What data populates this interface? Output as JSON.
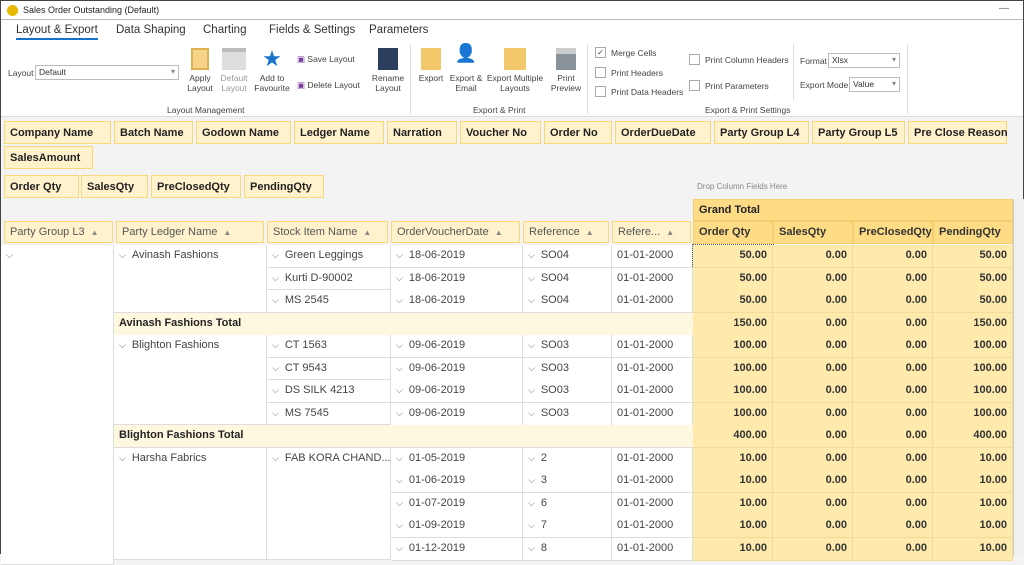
{
  "window": {
    "title": "Sales Order Outstanding (Default)",
    "minimize": "—"
  },
  "tabs": [
    "Layout & Export",
    "Data Shaping",
    "Charting",
    "Fields & Settings",
    "Parameters"
  ],
  "ribbon": {
    "layout_label": "Layout",
    "layout_value": "Default",
    "apply": "Apply Layout",
    "default": "Default Layout",
    "favourite": "Add to Favourite",
    "save": "Save Layout",
    "delete": "Delete Layout",
    "rename": "Rename Layout",
    "group1": "Layout Management",
    "export": "Export",
    "export_email": "Export & Email",
    "export_multiple": "Export Multiple Layouts",
    "print_preview": "Print Preview",
    "group2": "Export & Print",
    "merge_cells": "Merge Cells",
    "merge_checked": true,
    "print_headers": "Print Headers",
    "print_data_headers": "Print Data Headers",
    "print_column_headers": "Print Column Headers",
    "print_parameters": "Print Parameters",
    "format_label": "Format",
    "format_value": "Xlsx",
    "mode_label": "Export Mode",
    "mode_value": "Value",
    "group3": "Export & Print Settings"
  },
  "filter_fields": [
    "Company Name",
    "Batch Name",
    "Godown Name",
    "Ledger Name",
    "Narration",
    "Voucher No",
    "Order No",
    "OrderDueDate",
    "Party Group L4",
    "Party Group L5",
    "Pre Close Reason",
    "SalesAmount"
  ],
  "data_fields": [
    "Order Qty",
    "SalesQty",
    "PreClosedQty",
    "PendingQty"
  ],
  "drop_hint": "Drop Column Fields Here",
  "row_headers": [
    "Party Group L3",
    "Party Ledger Name",
    "Stock Item Name",
    "OrderVoucherDate",
    "Reference",
    "Refere..."
  ],
  "grand_total": "Grand Total",
  "value_headers": [
    "Order Qty",
    "SalesQty",
    "PreClosedQty",
    "PendingQty"
  ],
  "groups": [
    {
      "ledger": "Avinash Fashions",
      "items": [
        {
          "stock": "Green Leggings",
          "rows": [
            {
              "date": "18-06-2019",
              "ref": "SO04",
              "refdate": "01-01-2000",
              "values": [
                "50.00",
                "0.00",
                "0.00",
                "50.00"
              ]
            }
          ]
        },
        {
          "stock": "Kurti D-90002",
          "rows": [
            {
              "date": "18-06-2019",
              "ref": "SO04",
              "refdate": "01-01-2000",
              "values": [
                "50.00",
                "0.00",
                "0.00",
                "50.00"
              ]
            }
          ]
        },
        {
          "stock": "MS 2545",
          "rows": [
            {
              "date": "18-06-2019",
              "ref": "SO04",
              "refdate": "01-01-2000",
              "values": [
                "50.00",
                "0.00",
                "0.00",
                "50.00"
              ]
            }
          ]
        }
      ],
      "total": {
        "label": "Avinash Fashions Total",
        "values": [
          "150.00",
          "0.00",
          "0.00",
          "150.00"
        ]
      }
    },
    {
      "ledger": "Blighton Fashions",
      "items": [
        {
          "stock": "CT 1563",
          "rows": [
            {
              "date": "09-06-2019",
              "ref": "SO03",
              "refdate": "01-01-2000",
              "values": [
                "100.00",
                "0.00",
                "0.00",
                "100.00"
              ]
            }
          ]
        },
        {
          "stock": "CT 9543",
          "rows": [
            {
              "date": "09-06-2019",
              "ref": "SO03",
              "refdate": "01-01-2000",
              "values": [
                "100.00",
                "0.00",
                "0.00",
                "100.00"
              ]
            }
          ]
        },
        {
          "stock": "DS SILK 4213",
          "rows": [
            {
              "date": "09-06-2019",
              "ref": "SO03",
              "refdate": "01-01-2000",
              "values": [
                "100.00",
                "0.00",
                "0.00",
                "100.00"
              ]
            }
          ]
        },
        {
          "stock": "MS 7545",
          "rows": [
            {
              "date": "09-06-2019",
              "ref": "SO03",
              "refdate": "01-01-2000",
              "values": [
                "100.00",
                "0.00",
                "0.00",
                "100.00"
              ]
            }
          ]
        }
      ],
      "total": {
        "label": "Blighton Fashions Total",
        "values": [
          "400.00",
          "0.00",
          "0.00",
          "400.00"
        ]
      }
    },
    {
      "ledger": "Harsha Fabrics",
      "items": [
        {
          "stock": "FAB KORA CHAND...",
          "rows": [
            {
              "date": "01-05-2019",
              "ref": "2",
              "refdate": "01-01-2000",
              "values": [
                "10.00",
                "0.00",
                "0.00",
                "10.00"
              ]
            },
            {
              "date": "01-06-2019",
              "ref": "3",
              "refdate": "01-01-2000",
              "values": [
                "10.00",
                "0.00",
                "0.00",
                "10.00"
              ]
            },
            {
              "date": "01-07-2019",
              "ref": "6",
              "refdate": "01-01-2000",
              "values": [
                "10.00",
                "0.00",
                "0.00",
                "10.00"
              ]
            },
            {
              "date": "01-09-2019",
              "ref": "7",
              "refdate": "01-01-2000",
              "values": [
                "10.00",
                "0.00",
                "0.00",
                "10.00"
              ]
            },
            {
              "date": "01-12-2019",
              "ref": "8",
              "refdate": "01-01-2000",
              "values": [
                "10.00",
                "0.00",
                "0.00",
                "10.00"
              ]
            }
          ]
        }
      ],
      "total": null
    }
  ]
}
